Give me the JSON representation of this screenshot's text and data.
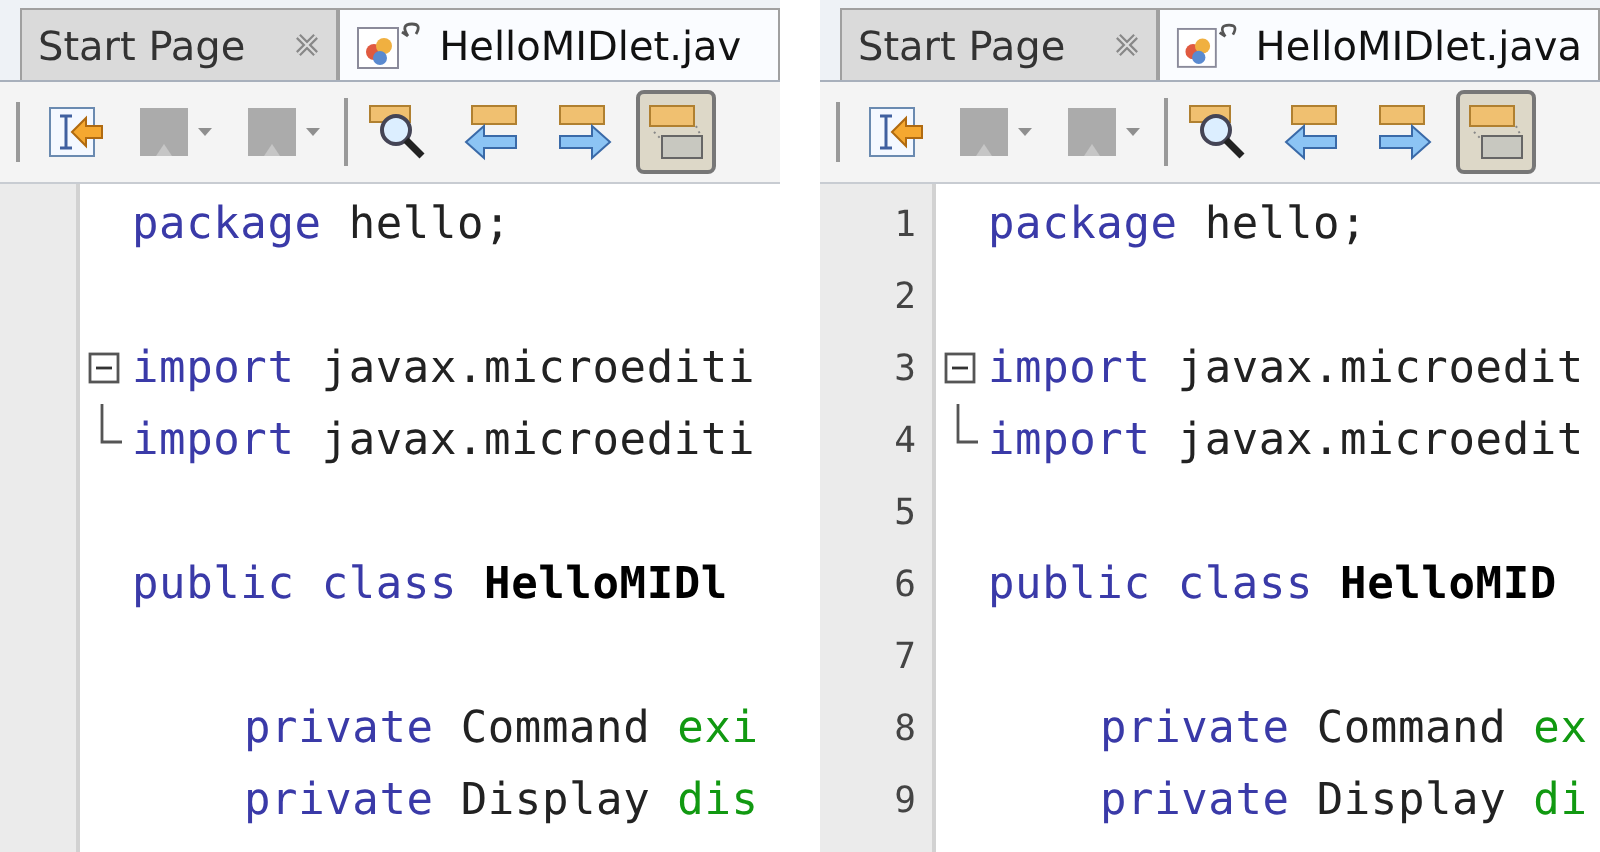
{
  "panels": [
    {
      "tabs": [
        {
          "label": "Start Page",
          "selected": false,
          "closable": true
        },
        {
          "label": "HelloMIDlet.jav",
          "selected": true
        }
      ],
      "toolbar": [
        {
          "kind": "source"
        },
        {
          "kind": "history",
          "disabled": true
        },
        {
          "kind": "history",
          "disabled": true
        },
        {
          "kind": "separator"
        },
        {
          "kind": "find"
        },
        {
          "kind": "previous"
        },
        {
          "kind": "next"
        },
        {
          "kind": "toggle",
          "selected": true
        }
      ],
      "lines": [
        {
          "kind": "code",
          "tokens": [
            {
              "kind": "keyword",
              "text": "package"
            },
            {
              "kind": "plain",
              "text": "hello;"
            }
          ]
        },
        {
          "kind": "blank"
        },
        {
          "kind": "fold-start",
          "tokens": [
            {
              "kind": "keyword",
              "text": "import"
            },
            {
              "kind": "plain",
              "text": "javax.microediti"
            }
          ]
        },
        {
          "kind": "fold-end",
          "tokens": [
            {
              "kind": "keyword",
              "text": "import"
            },
            {
              "kind": "plain",
              "text": "javax.microediti"
            }
          ]
        },
        {
          "kind": "blank"
        },
        {
          "kind": "code",
          "tokens": [
            {
              "kind": "keyword",
              "text": "public class"
            },
            {
              "kind": "classname",
              "text": "HelloMIDl"
            }
          ]
        },
        {
          "kind": "blank"
        },
        {
          "kind": "code",
          "indented": true,
          "tokens": [
            {
              "kind": "keyword",
              "text": "private"
            },
            {
              "kind": "plain",
              "text": "Command"
            },
            {
              "kind": "field",
              "text": "exi"
            }
          ]
        },
        {
          "kind": "code",
          "indented": true,
          "tokens": [
            {
              "kind": "keyword",
              "text": "private"
            },
            {
              "kind": "plain",
              "text": "Display"
            },
            {
              "kind": "field",
              "text": "dis"
            }
          ]
        }
      ]
    },
    {
      "tabs": [
        {
          "label": "Start Page",
          "selected": false,
          "closable": true
        },
        {
          "label": "HelloMIDlet.java",
          "selected": true
        }
      ],
      "toolbar": [
        {
          "kind": "source"
        },
        {
          "kind": "history",
          "disabled": true
        },
        {
          "kind": "history",
          "disabled": true
        },
        {
          "kind": "separator"
        },
        {
          "kind": "find"
        },
        {
          "kind": "previous"
        },
        {
          "kind": "next"
        },
        {
          "kind": "toggle",
          "selected": true
        }
      ],
      "lines": [
        {
          "number": "1",
          "kind": "code",
          "tokens": [
            {
              "kind": "keyword",
              "text": "package"
            },
            {
              "kind": "plain",
              "text": "hello;"
            }
          ]
        },
        {
          "number": "2",
          "kind": "blank"
        },
        {
          "number": "3",
          "kind": "fold-start",
          "tokens": [
            {
              "kind": "keyword",
              "text": "import"
            },
            {
              "kind": "plain",
              "text": "javax.microedit"
            }
          ]
        },
        {
          "number": "4",
          "kind": "fold-end",
          "tokens": [
            {
              "kind": "keyword",
              "text": "import"
            },
            {
              "kind": "plain",
              "text": "javax.microedit"
            }
          ]
        },
        {
          "number": "5",
          "kind": "blank"
        },
        {
          "number": "6",
          "kind": "code",
          "tokens": [
            {
              "kind": "keyword",
              "text": "public class"
            },
            {
              "kind": "classname",
              "text": "HelloMID"
            }
          ]
        },
        {
          "number": "7",
          "kind": "blank"
        },
        {
          "number": "8",
          "kind": "code",
          "indented": true,
          "tokens": [
            {
              "kind": "keyword",
              "text": "private"
            },
            {
              "kind": "plain",
              "text": "Command"
            },
            {
              "kind": "field",
              "text": "ex"
            }
          ]
        },
        {
          "number": "9",
          "kind": "code",
          "indented": true,
          "tokens": [
            {
              "kind": "keyword",
              "text": "private"
            },
            {
              "kind": "plain",
              "text": "Display"
            },
            {
              "kind": "field",
              "text": "di"
            }
          ]
        }
      ]
    }
  ]
}
